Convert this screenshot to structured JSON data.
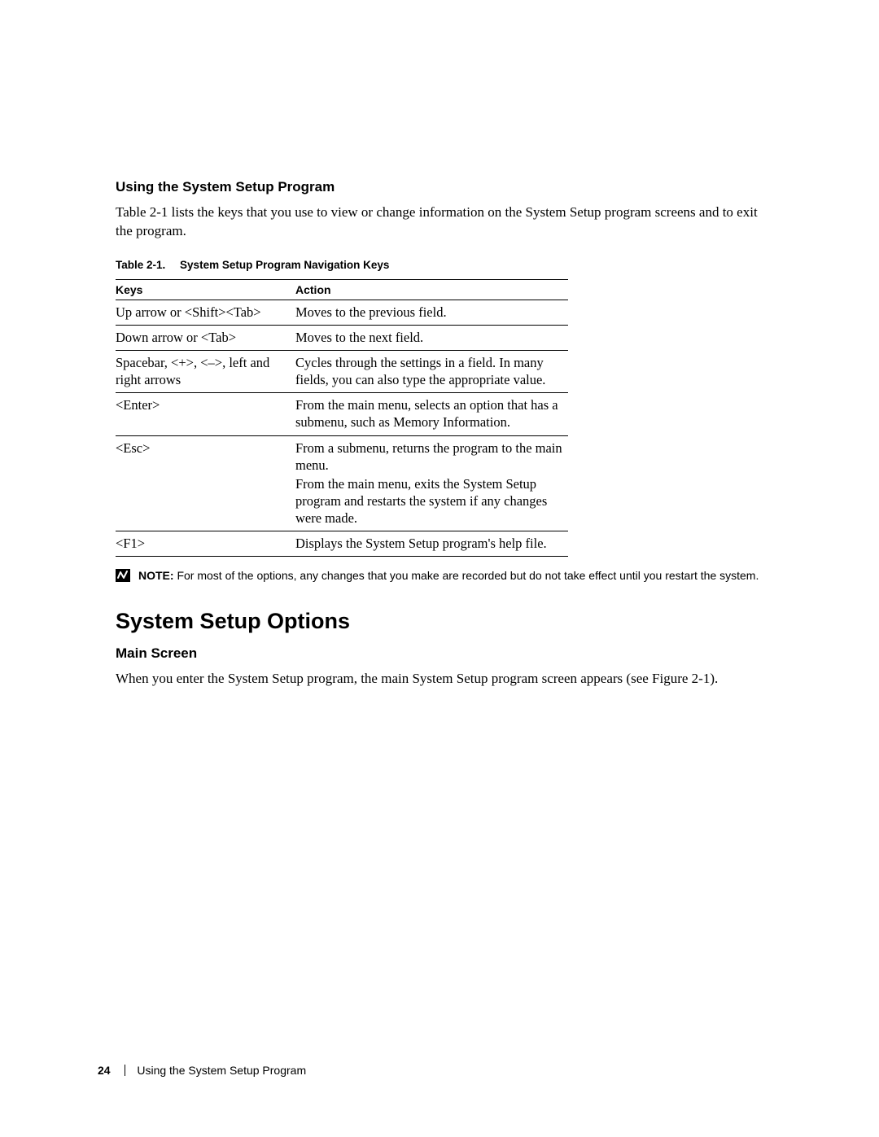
{
  "section1": {
    "heading": "Using the System Setup Program",
    "paragraph": "Table 2-1 lists the keys that you use to view or change information on the System Setup program screens and to exit the program."
  },
  "table": {
    "caption_number": "Table 2-1.",
    "caption_title": "System Setup Program Navigation Keys",
    "head": {
      "keys": "Keys",
      "action": "Action"
    },
    "rows": [
      {
        "keys": "Up arrow or <Shift><Tab>",
        "action": "Moves to the previous field."
      },
      {
        "keys": "Down arrow or <Tab>",
        "action": "Moves to the next field."
      },
      {
        "keys": "Spacebar, <+>, <–>, left and right arrows",
        "action": "Cycles through the settings in a field. In many fields, you can also type the appropriate value."
      },
      {
        "keys": "<Enter>",
        "action": "From the main menu, selects an option that has a submenu, such as Memory Information."
      },
      {
        "keys": "<Esc>",
        "action1": "From a submenu, returns the program to the main menu.",
        "action2": "From the main menu, exits the System Setup program and restarts the system if any changes were made."
      },
      {
        "keys": "<F1>",
        "action": "Displays the System Setup program's help file."
      }
    ]
  },
  "note": {
    "label": "NOTE:",
    "text": " For most of the options, any changes that you make are recorded but do not take effect until you restart the system."
  },
  "section2": {
    "heading": "System Setup Options",
    "subheading": "Main Screen",
    "paragraph": "When you enter the System Setup program, the main System Setup program screen appears (see Figure 2-1)."
  },
  "footer": {
    "page_number": "24",
    "title": "Using the System Setup Program"
  }
}
